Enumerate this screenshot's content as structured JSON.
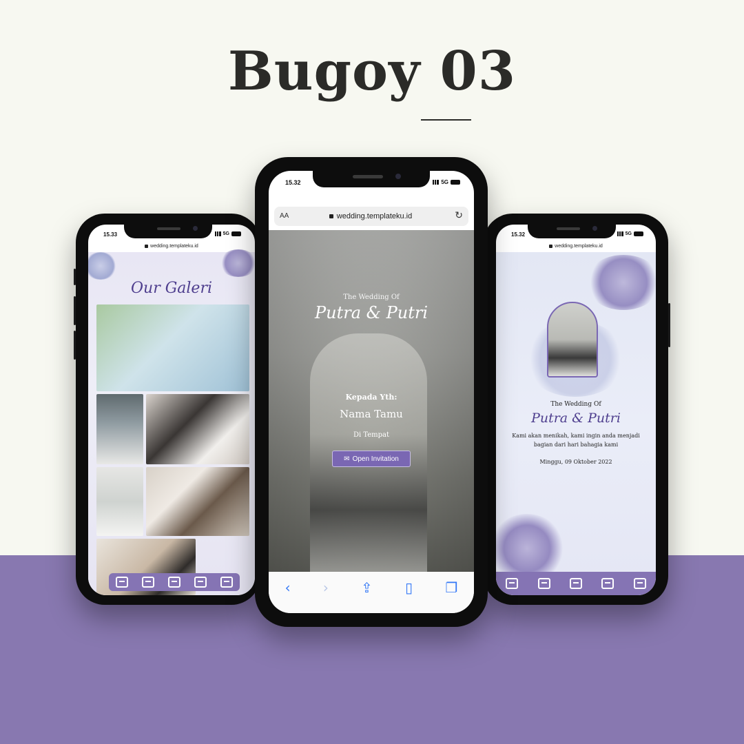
{
  "page": {
    "title": "Bugoy 03",
    "colors": {
      "background": "#f7f8f1",
      "accent": "#8878b0",
      "button": "#7a67b3",
      "script": "#4e3e8e"
    }
  },
  "left_phone": {
    "status_time": "15.33",
    "network": "5G",
    "url": "wedding.templateku.id",
    "section_title": "Our Galeri",
    "nav_icons": [
      "envelope-heart-icon",
      "couple-icon",
      "calendar-icon",
      "photo-heart-icon",
      "guestbook-icon"
    ]
  },
  "center_phone": {
    "status_time": "15.32",
    "network": "5G",
    "text_size_label": "AA",
    "url": "wedding.templateku.id",
    "wedding_of": "The Wedding Of",
    "couple": "Putra & Putri",
    "kepada": "Kepada Yth:",
    "guest_name": "Nama Tamu",
    "place": "Di Tempat",
    "open_button": "Open Invitation",
    "browser_icons": [
      "back-icon",
      "forward-icon",
      "share-icon",
      "bookmarks-icon",
      "tabs-icon"
    ]
  },
  "right_phone": {
    "status_time": "15.32",
    "network": "5G",
    "url": "wedding.templateku.id",
    "wedding_of": "The Wedding Of",
    "couple": "Putra & Putri",
    "message": "Kami akan menikah, kami ingin anda menjadi bagian dari hari bahagia kami",
    "date": "Minggu, 09 Oktober 2022",
    "nav_icons": [
      "envelope-heart-icon",
      "couple-icon",
      "calendar-icon",
      "photo-heart-icon",
      "guestbook-icon"
    ]
  }
}
